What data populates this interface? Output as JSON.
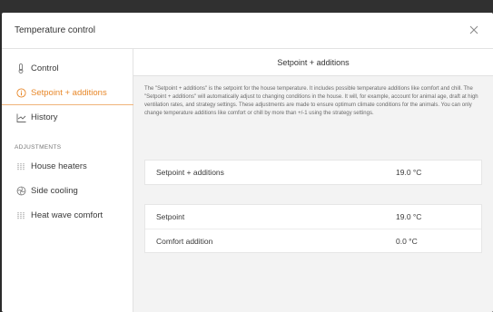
{
  "dialog": {
    "title": "Temperature control",
    "close_icon": "close-icon"
  },
  "sidebar": {
    "items": [
      {
        "label": "Control",
        "icon": "thermometer-icon",
        "active": false
      },
      {
        "label": "Setpoint + additions",
        "icon": "info-icon",
        "active": true
      },
      {
        "label": "History",
        "icon": "chart-icon",
        "active": false
      }
    ],
    "section_label": "ADJUSTMENTS",
    "adjustments": [
      {
        "label": "House heaters",
        "icon": "heater-icon"
      },
      {
        "label": "Side cooling",
        "icon": "fan-icon"
      },
      {
        "label": "Heat wave comfort",
        "icon": "heater-icon"
      }
    ]
  },
  "main": {
    "header": "Setpoint + additions",
    "description": "The \"Setpoint + additions\" is the setpoint for the house temperature. It includes possible temperature additions like comfort and chill. The \"Setpoint + additions\" will automatically adjust to changing conditions in the house. It will, for example, account for animal age, draft at high ventilation rates, and strategy settings. These adjustments are made to ensure optimum climate conditions for the animals. You can only change temperature additions like comfort or chill by more than +/-1 using the strategy settings.",
    "summary": [
      {
        "label": "Setpoint + additions",
        "value": "19.0 °C"
      }
    ],
    "details": [
      {
        "label": "Setpoint",
        "value": "19.0 °C"
      },
      {
        "label": "Comfort addition",
        "value": "0.0 °C"
      }
    ]
  },
  "colors": {
    "accent": "#e8882a",
    "content_bg": "#f3f3f3"
  }
}
